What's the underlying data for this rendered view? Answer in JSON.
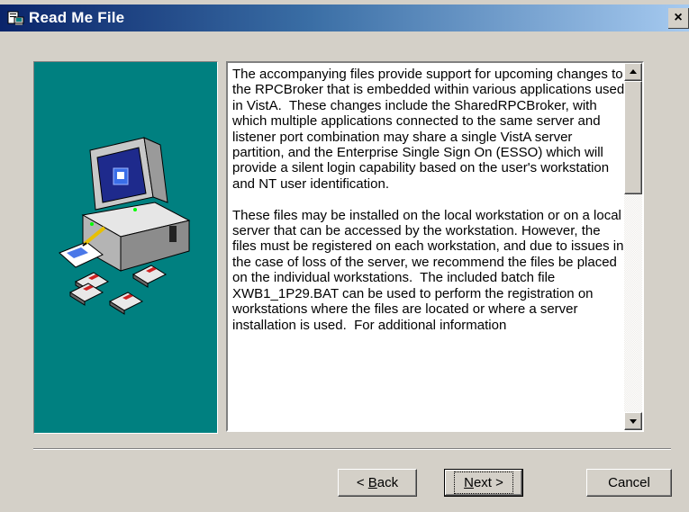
{
  "window": {
    "title": "Read Me File",
    "title_icon": "setup-icon",
    "close_label": "×"
  },
  "readme": {
    "text": "The accompanying files provide support for upcoming changes to the RPCBroker that is embedded within various applications used in VistA.  These changes include the SharedRPCBroker, with which multiple applications connected to the same server and listener port combination may share a single VistA server partition, and the Enterprise Single Sign On (ESSO) which will provide a silent login capability based on the user's workstation and NT user identification.\n\nThese files may be installed on the local workstation or on a local server that can be accessed by the workstation. However, the files must be registered on each workstation, and due to issues in the case of loss of the server, we recommend the files be placed on the individual workstations.  The included batch file XWB1_1P29.BAT can be used to perform the registration on workstations where the files are located or where a server installation is used.  For additional information"
  },
  "buttons": {
    "back_prefix": "< ",
    "back_mnemonic": "B",
    "back_rest": "ack",
    "next_mnemonic": "N",
    "next_rest": "ext >",
    "cancel": "Cancel"
  },
  "colors": {
    "title_gradient_start": "#0a246a",
    "title_gradient_end": "#a6caf0",
    "dialog_face": "#d4d0c8",
    "side_panel": "#008080"
  }
}
